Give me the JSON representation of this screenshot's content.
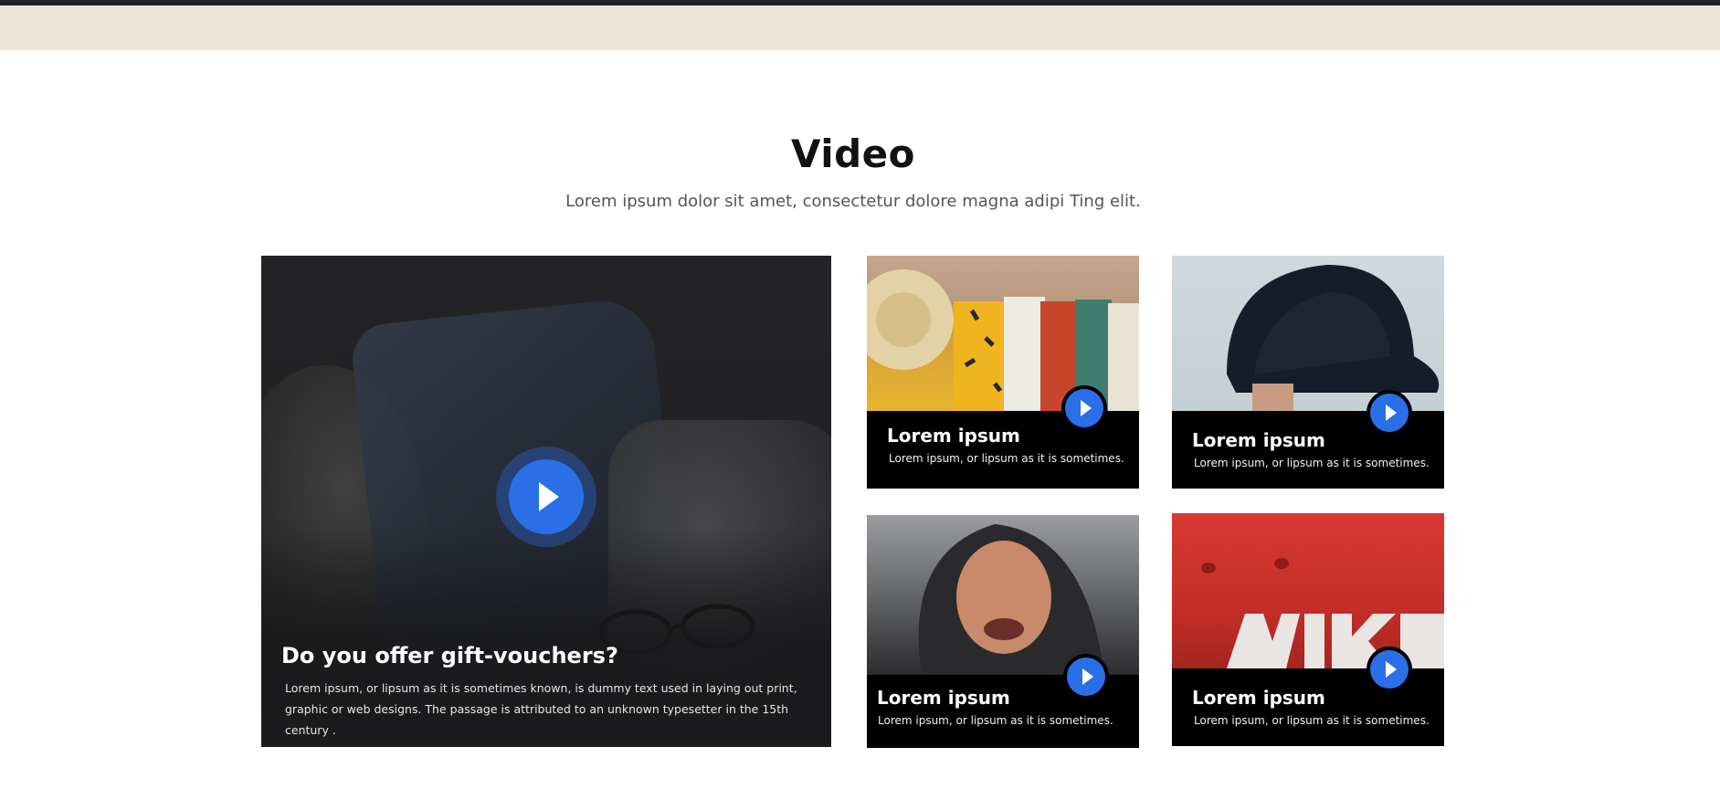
{
  "section": {
    "title": "Video",
    "subtitle": "Lorem ipsum dolor sit amet, consectetur dolore magna adipi Ting elit."
  },
  "featured": {
    "title": "Do you offer gift-vouchers?",
    "description": "Lorem ipsum, or lipsum as it is sometimes known, is dummy text used in laying out print, graphic or web designs. The passage is attributed to an unknown typesetter in the 15th century ."
  },
  "cards": [
    {
      "title": "Lorem ipsum",
      "description": "Lorem ipsum, or lipsum as it is sometimes."
    },
    {
      "title": "Lorem ipsum",
      "description": "Lorem ipsum, or lipsum as it is sometimes."
    },
    {
      "title": "Lorem ipsum",
      "description": "Lorem ipsum, or lipsum as it is sometimes."
    },
    {
      "title": "Lorem ipsum",
      "description": "Lorem ipsum, or lipsum as it is sometimes."
    }
  ],
  "colors": {
    "accent": "#2b6fe8",
    "header_band": "#ede4da",
    "top_bar": "#1e2124"
  }
}
